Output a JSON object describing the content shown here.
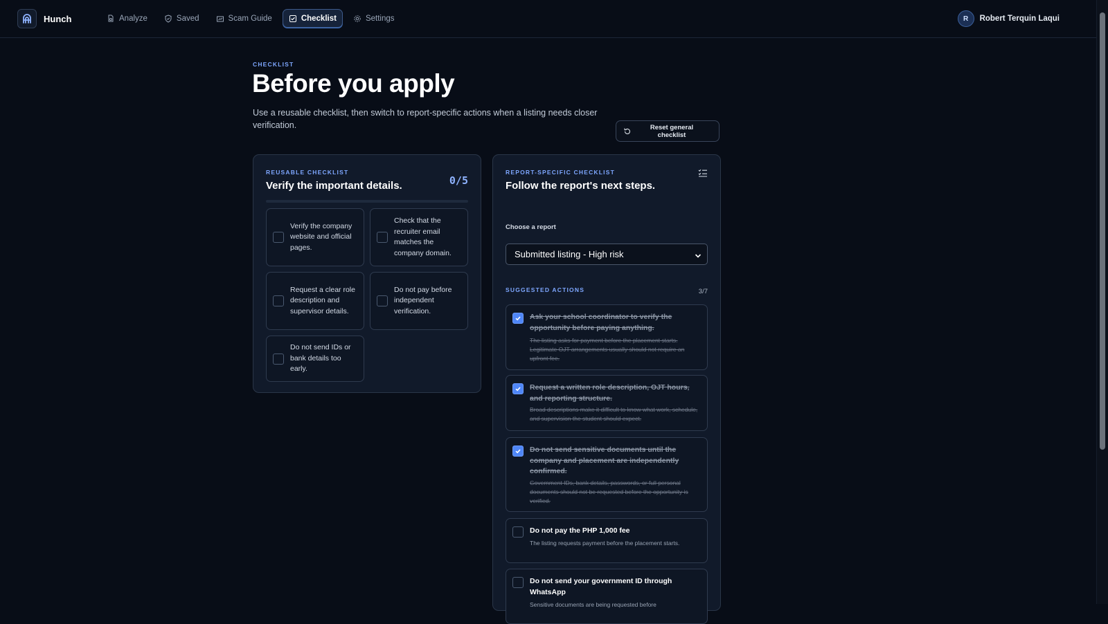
{
  "app": {
    "name": "Hunch"
  },
  "nav": {
    "items": [
      {
        "label": "Analyze",
        "icon": "file-search-icon",
        "active": false
      },
      {
        "label": "Saved",
        "icon": "shield-icon",
        "active": false
      },
      {
        "label": "Scam Guide",
        "icon": "guide-icon",
        "active": false
      },
      {
        "label": "Checklist",
        "icon": "checklist-icon",
        "active": true
      },
      {
        "label": "Settings",
        "icon": "gear-icon",
        "active": false
      }
    ]
  },
  "user": {
    "initial": "R",
    "name": "Robert Terquin Laqui"
  },
  "header": {
    "eyebrow": "CHECKLIST",
    "title": "Before you apply",
    "description": "Use a reusable checklist, then switch to report-specific actions when a listing needs closer verification.",
    "reset_label": "Reset general checklist"
  },
  "reusable": {
    "eyebrow": "REUSABLE CHECKLIST",
    "title": "Verify the important details.",
    "progress": "0/5",
    "progress_fraction": 0,
    "items": [
      {
        "label": "Verify the company website and official pages.",
        "checked": false
      },
      {
        "label": "Check that the recruiter email matches the company domain.",
        "checked": false
      },
      {
        "label": "Request a clear role description and supervisor details.",
        "checked": false
      },
      {
        "label": "Do not pay before independent verification.",
        "checked": false
      },
      {
        "label": "Do not send IDs or bank details too early.",
        "checked": false
      }
    ]
  },
  "report": {
    "eyebrow": "REPORT-SPECIFIC CHECKLIST",
    "title": "Follow the report's next steps.",
    "choose_label": "Choose a report",
    "selected_report": "Submitted listing - High risk",
    "suggested_eyebrow": "SUGGESTED ACTIONS",
    "suggested_count": "3/7",
    "actions": [
      {
        "title": "Ask your school coordinator to verify the opportunity before paying anything.",
        "description": "The listing asks for payment before the placement starts. Legitimate OJT arrangements usually should not require an upfront fee.",
        "checked": true
      },
      {
        "title": "Request a written role description, OJT hours, and reporting structure.",
        "description": "Broad descriptions make it difficult to know what work, schedule, and supervision the student should expect.",
        "checked": true
      },
      {
        "title": "Do not send sensitive documents until the company and placement are independently confirmed.",
        "description": "Government IDs, bank details, passwords, or full personal documents should not be requested before the opportunity is verified.",
        "checked": true
      },
      {
        "title": "Do not pay the PHP 1,000 fee",
        "description": "The listing requests payment before the placement starts.",
        "checked": false
      },
      {
        "title": "Do not send your government ID through WhatsApp",
        "description": "Sensitive documents are being requested before",
        "checked": false
      }
    ]
  },
  "colors": {
    "accent": "#4f86f7",
    "background": "#080d17",
    "card": "#111a2a",
    "eyebrow": "#7ea7ff"
  }
}
